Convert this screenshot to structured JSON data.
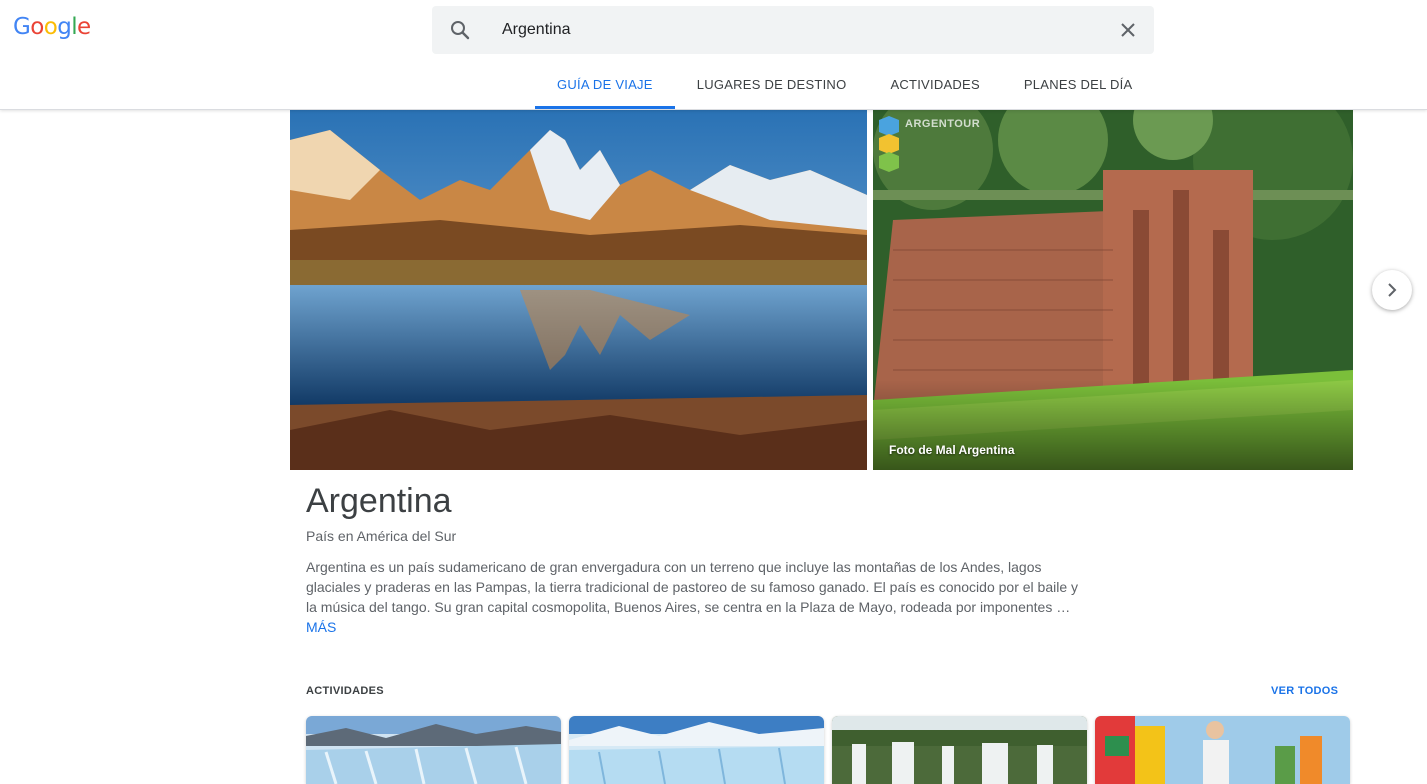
{
  "logo": "Google",
  "brand_colors": {
    "blue": "#4285F4",
    "red": "#EA4335",
    "yellow": "#FBBC05",
    "green": "#34A853"
  },
  "search": {
    "value": "Argentina"
  },
  "tabs": [
    {
      "label": "GUÍA DE VIAJE",
      "active": true
    },
    {
      "label": "LUGARES DE DESTINO",
      "active": false
    },
    {
      "label": "ACTIVIDADES",
      "active": false
    },
    {
      "label": "PLANES DEL DÍA",
      "active": false
    }
  ],
  "hero": {
    "photo_credit": "Foto de Mal Argentina",
    "watermark": "ARGENTOUR"
  },
  "place": {
    "title": "Argentina",
    "subtitle": "País en América del Sur",
    "description": "Argentina es un país sudamericano de gran envergadura con un terreno que incluye las montañas de los Andes, lagos glaciales y praderas en las Pampas, la tierra tradicional de pastoreo de su famoso ganado. El país es conocido por el baile y la música del tango. Su gran capital cosmopolita, Buenos Aires, se centra en la Plaza de Mayo, rodeada por imponentes …",
    "more_label": "MÁS"
  },
  "activities": {
    "title": "ACTIVIDADES",
    "see_all": "VER TODOS"
  },
  "accent_color": "#1a73e8"
}
